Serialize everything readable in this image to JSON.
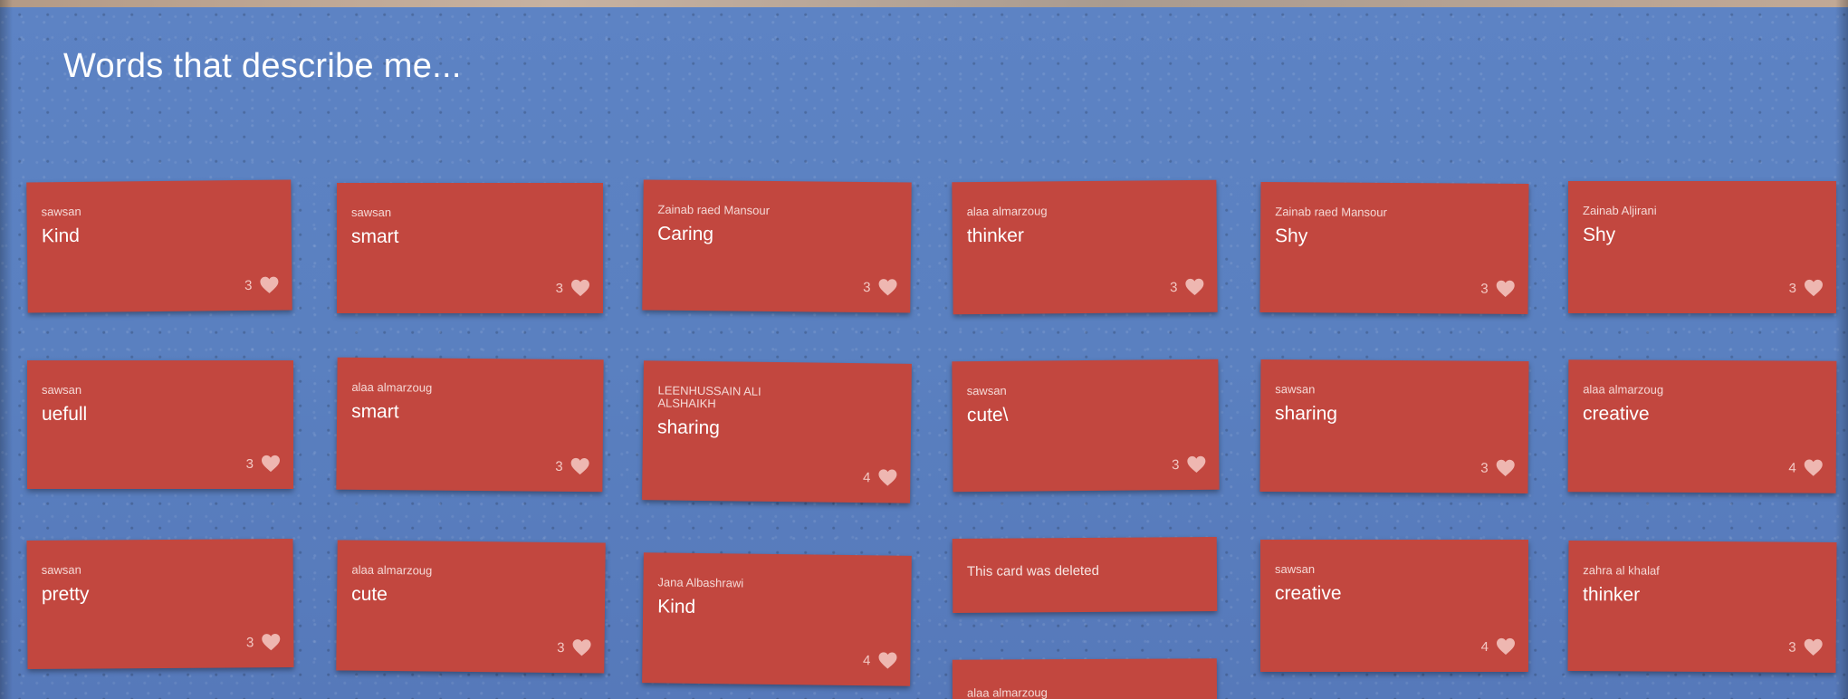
{
  "board": {
    "title": "Words that describe me..."
  },
  "colors": {
    "background": "#5a80c0",
    "card": "#c2473f",
    "heart": "#eeb7b1"
  },
  "cards": [
    {
      "author": "sawsan",
      "word": "Kind",
      "likes": "3"
    },
    {
      "author": "sawsan",
      "word": "smart",
      "likes": "3"
    },
    {
      "author": "Zainab raed Mansour",
      "word": "Caring",
      "likes": "3"
    },
    {
      "author": "alaa almarzoug",
      "word": "thinker",
      "likes": "3"
    },
    {
      "author": "Zainab raed Mansour",
      "word": "Shy",
      "likes": "3"
    },
    {
      "author": "Zainab Aljirani",
      "word": "Shy",
      "likes": "3"
    },
    {
      "author": "sawsan",
      "word": "uefull",
      "likes": "3"
    },
    {
      "author": "alaa almarzoug",
      "word": "smart",
      "likes": "3"
    },
    {
      "author": "LEENHUSSAIN ALI ALSHAIKH",
      "word": "sharing",
      "likes": "4"
    },
    {
      "author": "sawsan",
      "word": "cute\\",
      "likes": "3"
    },
    {
      "author": "sawsan",
      "word": "sharing",
      "likes": "3"
    },
    {
      "author": "alaa almarzoug",
      "word": "creative",
      "likes": "4"
    },
    {
      "author": "sawsan",
      "word": "pretty",
      "likes": "3"
    },
    {
      "author": "alaa almarzoug",
      "word": "cute",
      "likes": "3"
    },
    {
      "author": "Jana Albashrawi",
      "word": "Kind",
      "likes": "4"
    },
    {
      "author": "This card was deleted",
      "word": "",
      "likes": ""
    },
    {
      "author": "sawsan",
      "word": "creative",
      "likes": "4"
    },
    {
      "author": "zahra al khalaf",
      "word": "thinker",
      "likes": "3"
    },
    {
      "author": "alaa almarzoug",
      "word": "",
      "likes": ""
    }
  ]
}
